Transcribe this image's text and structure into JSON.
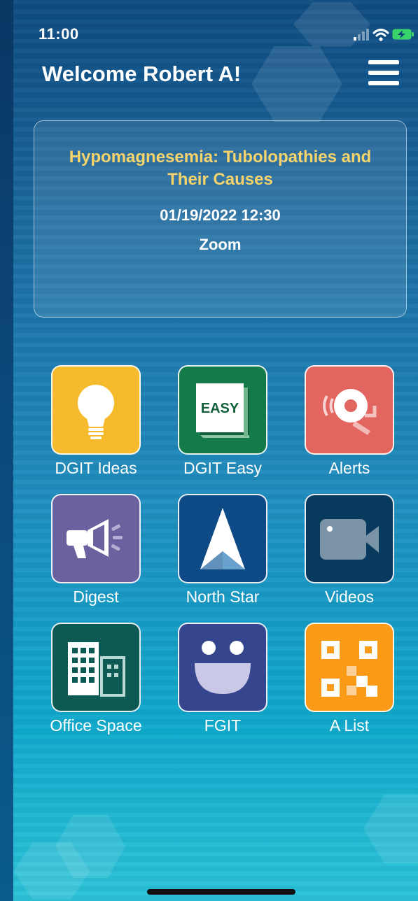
{
  "status_bar": {
    "time": "11:00"
  },
  "header": {
    "title": "Welcome Robert A!"
  },
  "event": {
    "title": "Hypomagnesemia: Tubolopathies and Their Causes",
    "datetime": "01/19/2022 12:30",
    "location": "Zoom"
  },
  "apps": [
    {
      "label": "DGIT Ideas",
      "icon": "lightbulb-icon",
      "color": "#f6bb2c"
    },
    {
      "label": "DGIT Easy",
      "icon": "easy-book-icon",
      "color": "#157a4a",
      "icon_text": "EASY"
    },
    {
      "label": "Alerts",
      "icon": "alarm-bell-icon",
      "color": "#e2665f"
    },
    {
      "label": "Digest",
      "icon": "megaphone-icon",
      "color": "#6a629f"
    },
    {
      "label": "North Star",
      "icon": "north-star-icon",
      "color": "#0e4a86"
    },
    {
      "label": "Videos",
      "icon": "video-camera-icon",
      "color": "#083a5e"
    },
    {
      "label": "Office Space",
      "icon": "buildings-icon",
      "color": "#0d5a55"
    },
    {
      "label": "FGIT",
      "icon": "smiley-face-icon",
      "color": "#35468f"
    },
    {
      "label": "A List",
      "icon": "qr-code-icon",
      "color": "#fb9a17"
    }
  ]
}
